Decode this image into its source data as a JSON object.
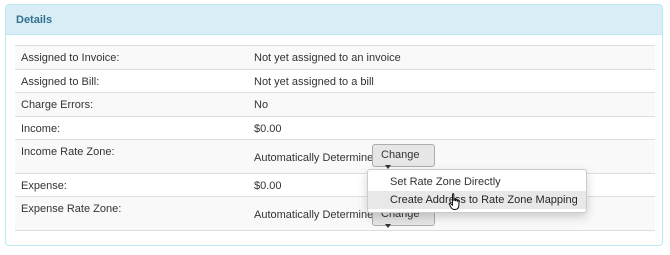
{
  "panel": {
    "title": "Details"
  },
  "rows": [
    {
      "label": "Assigned to Invoice:",
      "value": "Not yet assigned to an invoice"
    },
    {
      "label": "Assigned to Bill:",
      "value": "Not yet assigned to a bill"
    },
    {
      "label": "Charge Errors:",
      "value": "No"
    },
    {
      "label": "Income:",
      "value": "$0.00"
    },
    {
      "label": "Income Rate Zone:",
      "value": "Automatically Determine"
    },
    {
      "label": "Expense:",
      "value": "$0.00"
    },
    {
      "label": "Expense Rate Zone:",
      "value": "Automatically Determine"
    }
  ],
  "income_rate_zone": {
    "button_label": "Change"
  },
  "expense_rate_zone": {
    "button_label": "Change"
  },
  "dropdown": {
    "items": [
      {
        "label": "Set Rate Zone Directly"
      },
      {
        "label": "Create Address to Rate Zone Mapping"
      }
    ]
  },
  "colors": {
    "panel_heading_bg": "#d9edf7",
    "panel_heading_text": "#31708f",
    "panel_border": "#bce8f1"
  },
  "icons": {
    "cursor": "hand-pointer-icon"
  }
}
